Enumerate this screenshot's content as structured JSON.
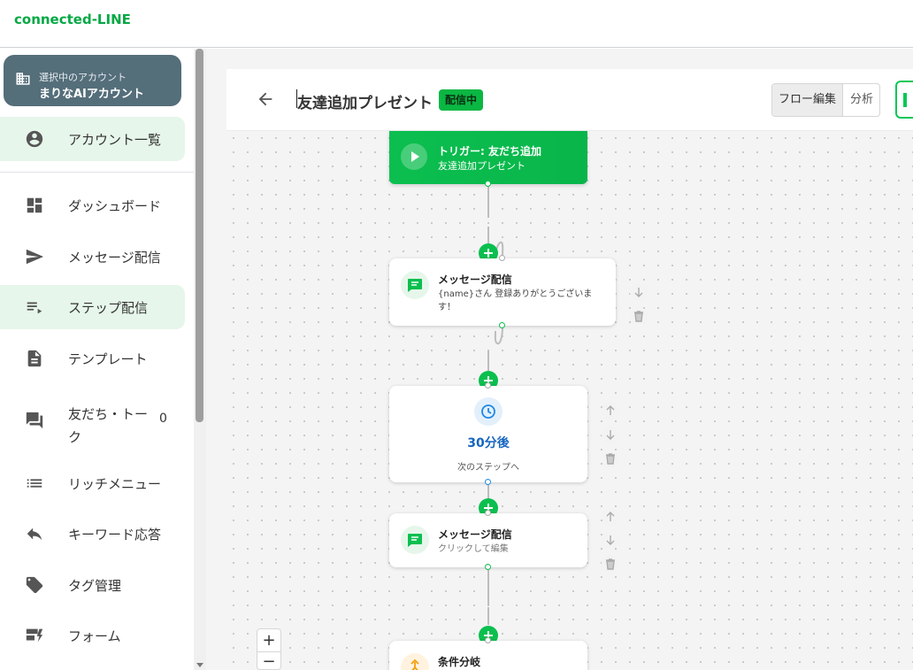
{
  "app": {
    "brand": "connected-LINE"
  },
  "sidebar": {
    "account_caption": "選択中のアカウント",
    "account_name": "まりなAIアカウント",
    "items": [
      {
        "label": "アカウント一覧",
        "icon": "account-circle-icon"
      },
      {
        "label": "ダッシュボード",
        "icon": "dashboard-icon"
      },
      {
        "label": "メッセージ配信",
        "icon": "send-icon"
      },
      {
        "label": "ステップ配信",
        "icon": "playlist-play-icon"
      },
      {
        "label": "テンプレート",
        "icon": "document-icon"
      },
      {
        "label": "友だち・トーク",
        "icon": "chat-icon",
        "count": "0"
      },
      {
        "label": "リッチメニュー",
        "icon": "list-icon"
      },
      {
        "label": "キーワード応答",
        "icon": "reply-icon"
      },
      {
        "label": "タグ管理",
        "icon": "tag-icon"
      },
      {
        "label": "フォーム",
        "icon": "form-icon"
      }
    ]
  },
  "header": {
    "title": "友達追加プレゼント",
    "status": "配信中",
    "tab_edit": "フロー編集",
    "tab_analytics": "分析"
  },
  "flow": {
    "trigger_title": "トリガー: 友だち追加",
    "trigger_sub": "友達追加プレゼント",
    "msg1_title": "メッセージ配信",
    "msg1_body": "{name}さん 登録ありがとうございます！",
    "wait_value": "30分後",
    "wait_sub": "次のステップへ",
    "msg2_title": "メッセージ配信",
    "msg2_body": "クリックして編集",
    "branch_title": "条件分岐"
  },
  "zoom": {
    "in": "+",
    "out": "−"
  },
  "colors": {
    "brand": "#06c755",
    "accent_dark": "#546e7a",
    "wait_blue": "#1565c0"
  }
}
